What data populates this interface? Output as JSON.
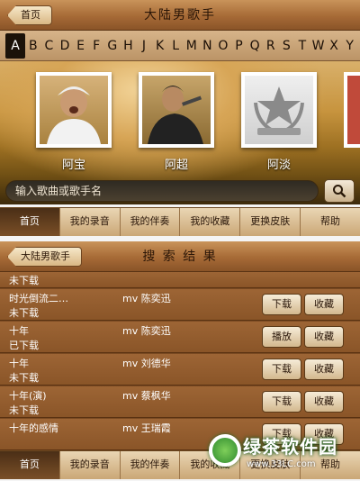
{
  "top": {
    "back_label": "首页",
    "title": "大陆男歌手",
    "alphabet": [
      "A",
      "B",
      "C",
      "D",
      "E",
      "F",
      "G",
      "H",
      "J",
      "K",
      "L",
      "M",
      "N",
      "O",
      "P",
      "Q",
      "R",
      "S",
      "T",
      "W",
      "X",
      "Y"
    ],
    "active_letter": "A",
    "singers": [
      {
        "name": "阿宝"
      },
      {
        "name": "阿超"
      },
      {
        "name": "阿淡"
      }
    ],
    "search_placeholder": "输入歌曲或歌手名"
  },
  "tabs": [
    "首页",
    "我的录音",
    "我的伴奏",
    "我的收藏",
    "更换皮肤",
    "帮助"
  ],
  "bottom": {
    "back_label": "大陆男歌手",
    "title": "搜 索 结 果",
    "rows": [
      {
        "title": "",
        "status": "未下载",
        "artist": "",
        "buttons": []
      },
      {
        "title": "时光倒流二…",
        "status": "未下载",
        "artist": "mv 陈奕迅",
        "buttons": [
          "下载",
          "收藏"
        ]
      },
      {
        "title": "十年",
        "status": "已下载",
        "artist": "mv 陈奕迅",
        "buttons": [
          "播放",
          "收藏"
        ]
      },
      {
        "title": "十年",
        "status": "未下载",
        "artist": "mv 刘德华",
        "buttons": [
          "下载",
          "收藏"
        ]
      },
      {
        "title": "十年(演)",
        "status": "未下载",
        "artist": "mv 蔡枫华",
        "buttons": [
          "下载",
          "收藏"
        ]
      },
      {
        "title": "十年的感情",
        "status": "",
        "artist": "mv 王瑞霞",
        "buttons": [
          "下载",
          "收藏"
        ]
      }
    ],
    "tabs": [
      "首页",
      "我的录音",
      "我的伴奏",
      "我的收藏",
      "更换皮肤",
      "帮助"
    ]
  },
  "watermark": {
    "text": "绿茶软件园",
    "url": "www.33LC.com"
  }
}
